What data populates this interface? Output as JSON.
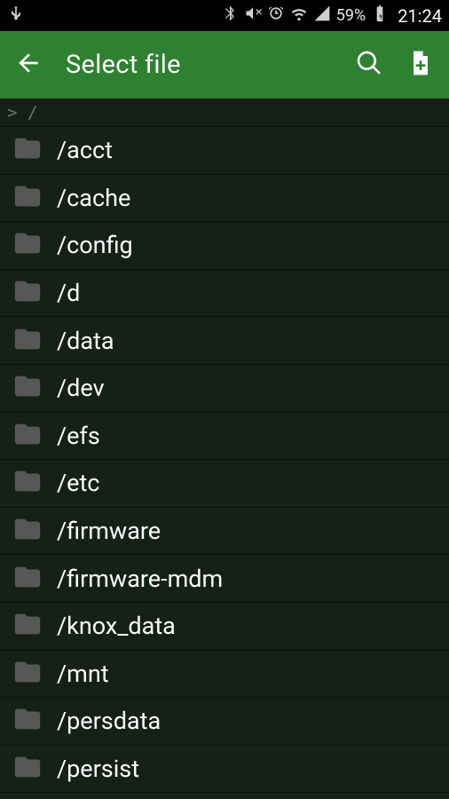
{
  "status_bar": {
    "battery_pct": "59%",
    "time": "21:24"
  },
  "action_bar": {
    "title": "Select file",
    "back_icon": "arrow-back",
    "search_icon": "search",
    "new_file_icon": "file-add"
  },
  "breadcrumb": {
    "text": "> /"
  },
  "files": [
    {
      "label": "/acct"
    },
    {
      "label": "/cache"
    },
    {
      "label": "/config"
    },
    {
      "label": "/d"
    },
    {
      "label": "/data"
    },
    {
      "label": "/dev"
    },
    {
      "label": "/efs"
    },
    {
      "label": "/etc"
    },
    {
      "label": "/firmware"
    },
    {
      "label": "/firmware-mdm"
    },
    {
      "label": "/knox_data"
    },
    {
      "label": "/mnt"
    },
    {
      "label": "/persdata"
    },
    {
      "label": "/persist"
    }
  ],
  "colors": {
    "accent": "#2f8132",
    "background": "#152116",
    "row_divider": "#0b130c",
    "folder_icon": "#575757",
    "text": "#fdfdfd"
  }
}
